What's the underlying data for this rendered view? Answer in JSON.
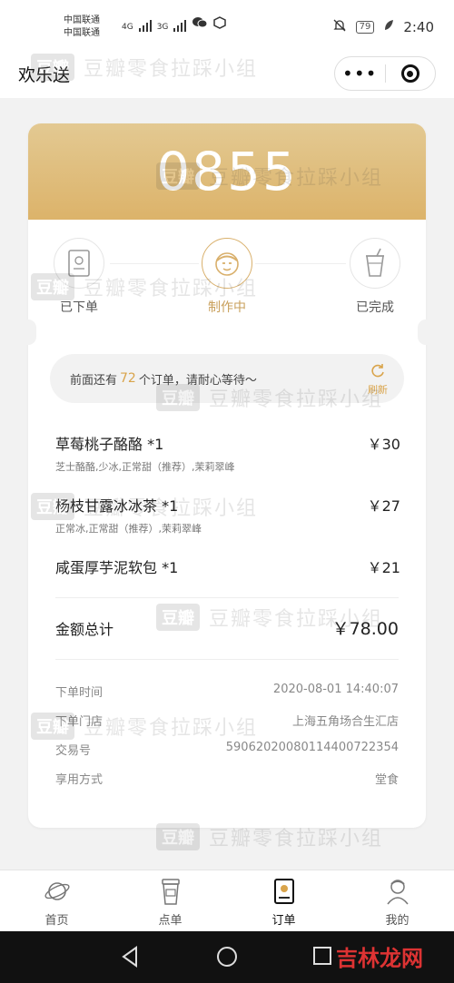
{
  "status_bar": {
    "carrier_1": "中国联通",
    "carrier_2": "中国联通",
    "net_1": "4G",
    "net_2": "3G",
    "battery": "79",
    "time": "2:40"
  },
  "nav": {
    "title": "欢乐送",
    "more_label": "•••"
  },
  "order": {
    "pickup_code": "0855",
    "steps": [
      {
        "label": "已下单",
        "icon": "receipt-icon"
      },
      {
        "label": "制作中",
        "icon": "chef-icon"
      },
      {
        "label": "已完成",
        "icon": "cup-icon"
      }
    ],
    "notice": {
      "prefix": "前面还有",
      "count": "72",
      "suffix": "个订单，请耐心等待～",
      "refresh_label": "刷新"
    },
    "items": [
      {
        "name": "草莓桃子酪酪 *1",
        "spec": "芝士酪酪,少冰,正常甜（推荐）,茉莉翠峰",
        "price": "￥30"
      },
      {
        "name": "杨枝甘露冰冰茶 *1",
        "spec": "正常冰,正常甜（推荐）,茉莉翠峰",
        "price": "￥27"
      },
      {
        "name": "咸蛋厚芋泥软包 *1",
        "spec": "",
        "price": "￥21"
      }
    ],
    "total_label": "金额总计",
    "total_value": "￥78.00",
    "info": [
      {
        "label": "下单时间",
        "value": "2020-08-01 14:40:07"
      },
      {
        "label": "下单门店",
        "value": "上海五角场合生汇店"
      },
      {
        "label": "交易号",
        "value": "59062020080114400722354"
      },
      {
        "label": "享用方式",
        "value": "堂食"
      }
    ]
  },
  "tabs": [
    {
      "label": "首页",
      "icon": "planet-icon"
    },
    {
      "label": "点单",
      "icon": "cup-icon"
    },
    {
      "label": "订单",
      "icon": "receipt-icon"
    },
    {
      "label": "我的",
      "icon": "person-icon"
    }
  ],
  "watermark": {
    "badge": "豆瓣",
    "text": "豆瓣零食拉踩小组",
    "corner": "吉林龙网"
  },
  "colors": {
    "accent": "#d9a44b",
    "header_gradient_top": "#e3c992",
    "header_gradient_bottom": "#dcb36a"
  }
}
